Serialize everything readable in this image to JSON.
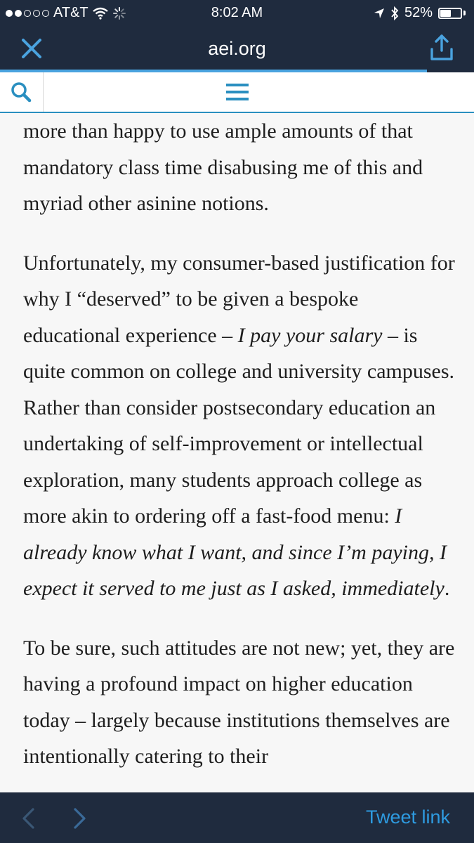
{
  "status_bar": {
    "carrier": "AT&T",
    "time": "8:02 AM",
    "battery_percent": "52%",
    "battery_level": 0.52,
    "signal_bars_filled": 2,
    "signal_bars_total": 5,
    "icons": [
      "wifi-icon",
      "loading-spinner-icon",
      "location-arrow-icon",
      "bluetooth-icon",
      "battery-icon"
    ]
  },
  "nav": {
    "title": "aei.org",
    "close_icon": "close-icon",
    "share_icon": "share-icon",
    "page_load_progress": 0.9
  },
  "site_header": {
    "search_icon": "search-icon",
    "menu_icon": "hamburger-menu-icon"
  },
  "article": {
    "p1": "more than happy to use ample amounts of that mandatory class time disabusing me of this and myriad other asinine notions.",
    "p2_a": "Unfortunately, my consumer-based justification for why I “deserved” to be given a bespoke educational experience – ",
    "p2_em1": "I pay your salary",
    "p2_b": " – is quite common on college and university campuses. Rather than consider postsecondary education an undertaking of self-improvement or intellectual exploration, many students approach college as more akin to ordering off a fast-food menu: ",
    "p2_em2": "I already know what I want, and since I’m paying, I expect it served to me just as I asked, immediately",
    "p2_c": ".",
    "p3": "To be sure, such attitudes are not new; yet, they are having a profound impact on higher education today – largely because institutions themselves are intentionally catering to their"
  },
  "toolbar": {
    "back_icon": "chevron-left-icon",
    "forward_icon": "chevron-right-icon",
    "tweet_link_label": "Tweet link"
  },
  "colors": {
    "bar_background": "#1f2b3e",
    "accent_blue": "#2a8fc0",
    "link_blue": "#2e9be0",
    "page_background": "#f7f7f7",
    "text": "#1e1e1e"
  }
}
